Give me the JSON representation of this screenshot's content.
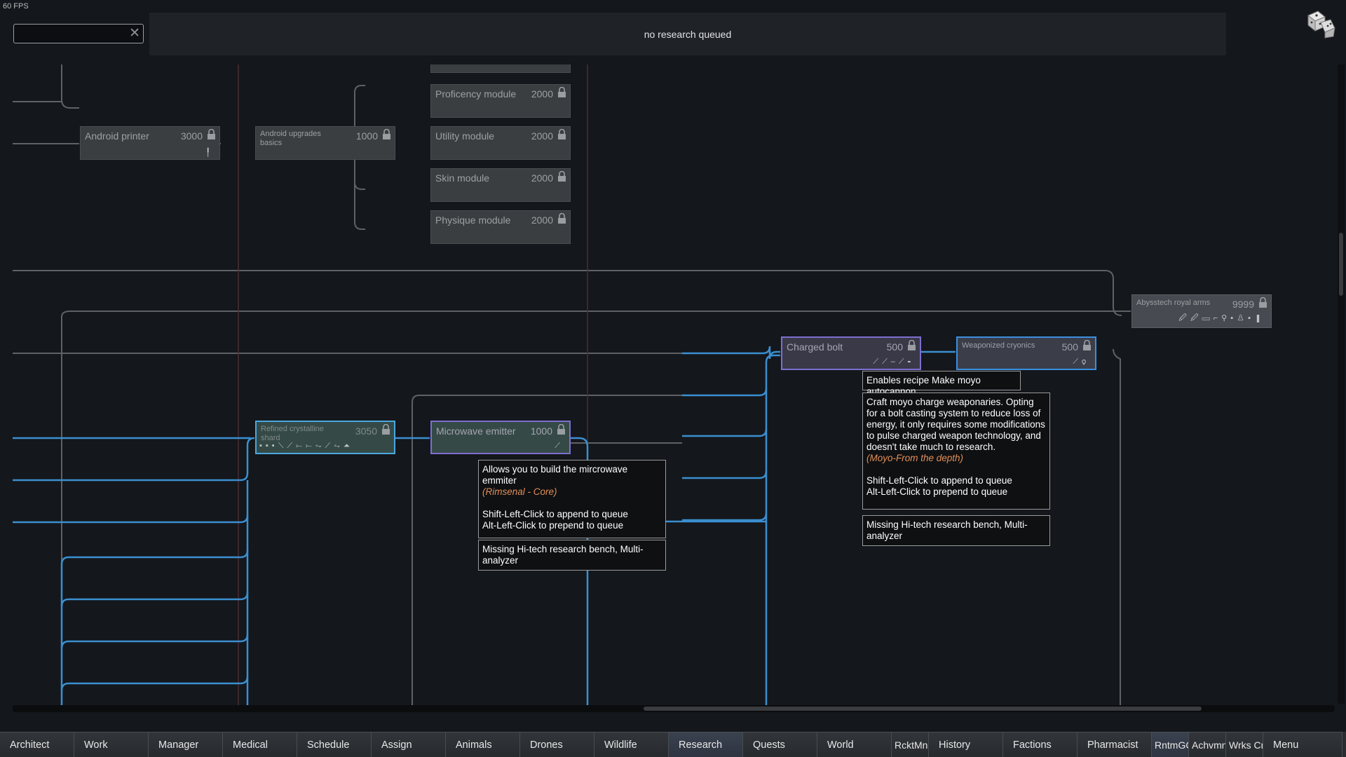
{
  "fps": "60 FPS",
  "search": {
    "value": "",
    "placeholder": ""
  },
  "queue": {
    "status": "no research queued"
  },
  "nodes": {
    "android_printer": {
      "name": "Android printer",
      "cost": "3000"
    },
    "android_upgrades": {
      "name": "Android upgrades basics",
      "cost": "1000"
    },
    "proficency_module": {
      "name": "Proficency module",
      "cost": "2000"
    },
    "utility_module": {
      "name": "Utility module",
      "cost": "2000"
    },
    "skin_module": {
      "name": "Skin module",
      "cost": "2000"
    },
    "physique_module": {
      "name": "Physique module",
      "cost": "2000"
    },
    "abyssal_arms": {
      "name": "Abysstech royal arms",
      "cost": "9999"
    },
    "charged_bolt": {
      "name": "Charged bolt",
      "cost": "500"
    },
    "weaponized_cryonics": {
      "name": "Weaponized cryonics",
      "cost": "500"
    },
    "refined_shard": {
      "name": "Refined crystalline shard",
      "cost": "3050"
    },
    "microwave_emitter": {
      "name": "Microwave emitter",
      "cost": "1000"
    }
  },
  "tooltips": {
    "microwave": {
      "desc": "Allows you to build the mircrowave emmiter",
      "source": "(Rimsenal - Core)",
      "shift": "Shift-Left-Click to append to queue",
      "alt": "Alt-Left-Click to prepend to queue",
      "missing": "Missing Hi-tech research bench, Multi-analyzer"
    },
    "charged": {
      "recipe": "Enables recipe Make moyo autocannon",
      "desc": "Craft moyo charge weaponaries. Opting for a bolt casting system to reduce loss of energy, it only requires some modifications to pulse charged weapon technology, and doesn't take much to research.",
      "source": "(Moyo-From the depth)",
      "shift": "Shift-Left-Click to append to queue",
      "alt": "Alt-Left-Click to prepend to queue",
      "missing": "Missing Hi-tech research bench, Multi-analyzer"
    }
  },
  "tabs": [
    "Architect",
    "Work",
    "Manager",
    "Medical",
    "Schedule",
    "Assign",
    "Animals",
    "Drones",
    "Wildlife",
    "Research",
    "Quests",
    "World",
    "RcktMn",
    "History",
    "Factions",
    "Pharmacist",
    "RntmGC",
    "Achvmn",
    "Wrks Cr",
    "Menu"
  ],
  "colors": {
    "research_link": "#4aa8df",
    "locked_link": "#5f6164",
    "accent_purple": "#7d6fd0",
    "source_text": "#e38f58"
  }
}
